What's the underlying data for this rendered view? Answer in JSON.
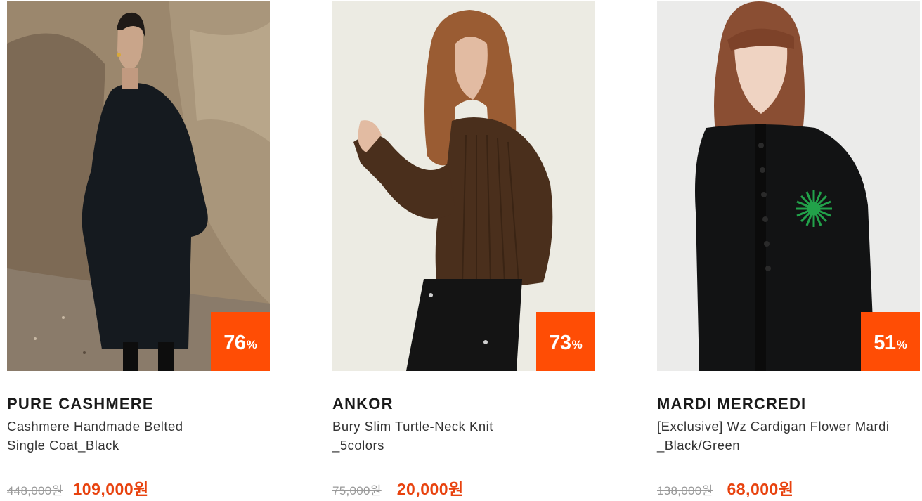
{
  "products": [
    {
      "brand": "PURE CASHMERE",
      "name_line1": "Cashmere Handmade Belted",
      "name_line2": "Single Coat_Black",
      "original_price": "448,000원",
      "sale_price": "109,000원",
      "discount": "76",
      "discount_unit": "%",
      "image_icon": "model-black-coat-image"
    },
    {
      "brand": "ANKOR",
      "name_line1": "Bury Slim Turtle-Neck Knit",
      "name_line2": "_5colors",
      "original_price": "75,000원",
      "sale_price": "20,000원",
      "discount": "73",
      "discount_unit": "%",
      "image_icon": "model-brown-knit-image"
    },
    {
      "brand": "MARDI MERCREDI",
      "name_line1": "[Exclusive] Wz Cardigan Flower Mardi",
      "name_line2": "_Black/Green",
      "original_price": "138,000원",
      "sale_price": "68,000원",
      "discount": "51",
      "discount_unit": "%",
      "image_icon": "model-black-cardigan-image"
    }
  ],
  "colors": {
    "badge": "#ff4d05",
    "sale_price": "#e8420e",
    "original_price": "#9a9a9a"
  }
}
